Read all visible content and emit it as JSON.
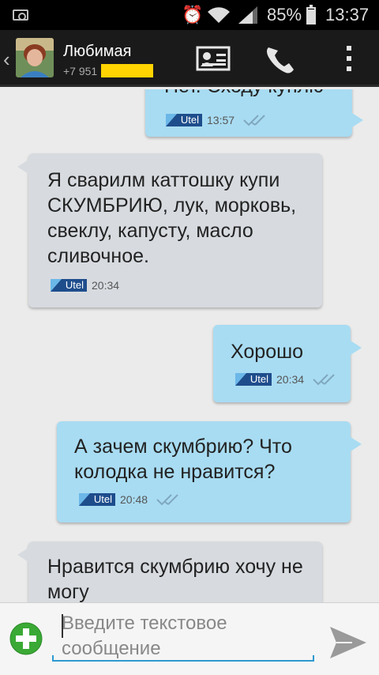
{
  "status_bar": {
    "battery_percent": "85%",
    "time": "13:37",
    "icons": [
      "camera-icon",
      "alarm-icon",
      "wifi-icon",
      "signal-icon",
      "battery-icon"
    ]
  },
  "header": {
    "back_icon": "chevron-left-icon",
    "contact_name": "Любимая",
    "contact_number": "+7 951",
    "actions": [
      "contact-card-icon",
      "phone-icon",
      "overflow-menu-icon"
    ]
  },
  "messages": [
    {
      "direction": "out",
      "text": "Нет. Сходу куплю",
      "operator": "Utel",
      "time": "13:57",
      "delivered": true
    },
    {
      "direction": "in",
      "text": "Я сварилм каттошку купи СКУМБРИЮ, лук, морковь, свеклу, капусту, масло сливочное.",
      "operator": "Utel",
      "time": "20:34",
      "delivered": false
    },
    {
      "direction": "out",
      "text": "Хорошо",
      "operator": "Utel",
      "time": "20:34",
      "delivered": true
    },
    {
      "direction": "out",
      "text": "А зачем скумбрию? Что колодка не нравится?",
      "operator": "Utel",
      "time": "20:48",
      "delivered": true
    },
    {
      "direction": "in",
      "text": "Нравится скумбрию хочу не могу",
      "operator": "",
      "time": "",
      "delivered": false
    }
  ],
  "composer": {
    "placeholder": "Введите текстовое сообщение",
    "value": "",
    "attach_icon": "add-attachment-icon",
    "send_icon": "send-icon"
  },
  "colors": {
    "incoming_bubble": "#d7dbe0",
    "outgoing_bubble": "#a8dcf2",
    "input_accent": "#2f9ad1",
    "attach_green": "#3aa935"
  }
}
